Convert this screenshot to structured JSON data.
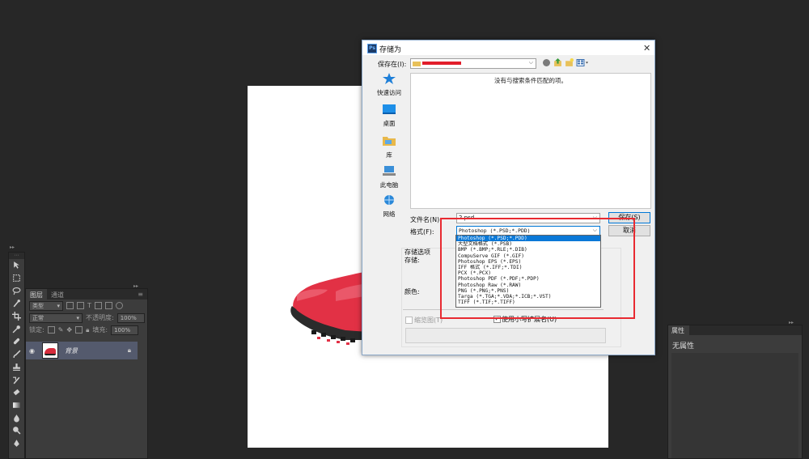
{
  "dialog": {
    "title": "存储为",
    "app_icon": "Ps",
    "close": "✕",
    "save_in_label": "保存在(I):",
    "empty_message": "没有与搜索条件匹配的项。",
    "filename_label": "文件名(N):",
    "filename_value": "2.psd",
    "format_label": "格式(F):",
    "format_selected": "Photoshop (*.PSD;*.PDD)",
    "format_options": [
      "Photoshop (*.PSD;*.PDD)",
      "大型文档格式 (*.PSB)",
      "BMP (*.BMP;*.RLE;*.DIB)",
      "CompuServe GIF (*.GIF)",
      "Photoshop EPS (*.EPS)",
      "IFF 格式 (*.IFF;*.TDI)",
      "PCX (*.PCX)",
      "Photoshop PDF (*.PDF;*.PDP)",
      "Photoshop Raw (*.RAW)",
      "PNG (*.PNG;*.PNS)",
      "Targa (*.TGA;*.VDA;*.ICB;*.VST)",
      "TIFF (*.TIF;*.TIFF)"
    ],
    "save_button": "保存(S)",
    "cancel_button": "取消",
    "places": [
      "快速访问",
      "桌面",
      "库",
      "此电脑",
      "网络"
    ],
    "save_options_label": "存储选项",
    "store_label": "存储:",
    "color_label": "颜色:",
    "thumbnail_label": "缩览图(T)",
    "lowercase_ext_label": "使用小写扩展名(U)",
    "lowercase_ext_checked": true
  },
  "layers_panel": {
    "tabs": [
      "图层",
      "通道"
    ],
    "filter_label": "类型",
    "blend_mode": "正常",
    "opacity_label": "不透明度:",
    "opacity_value": "100%",
    "lock_label": "锁定:",
    "fill_label": "填充:",
    "fill_value": "100%",
    "layer_name": "背景"
  },
  "properties_panel": {
    "tab": "属性",
    "empty_text": "无属性"
  },
  "colors": {
    "workspace": "#272727",
    "panel": "#3c3c3c",
    "highlight": "#e82a31",
    "selection": "#0a78d7"
  }
}
